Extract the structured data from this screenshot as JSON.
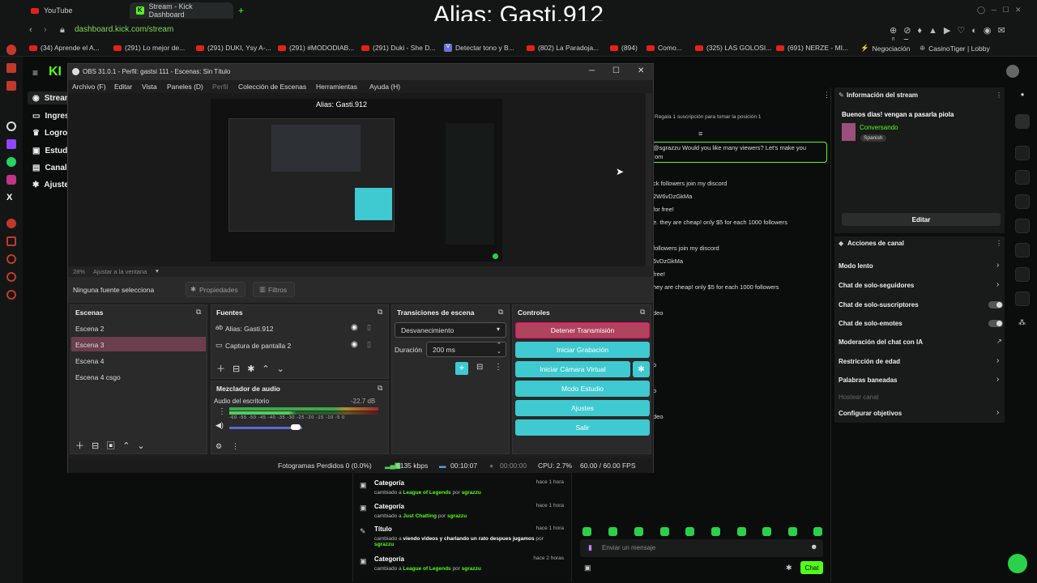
{
  "overlay_title": "Alias: Gasti.912",
  "browser": {
    "tabs": [
      {
        "label": "YouTube"
      },
      {
        "label": "Stream - Kick Dashboard"
      }
    ],
    "new_tab": "+",
    "url": "dashboard.kick.com/stream",
    "bookmarks": [
      "(34) Aprende el A...",
      "(291) Lo mejor de...",
      "(291) DUKI, Ysy A-...",
      "(291) #MODODIAB...",
      "(291) Duki - She D...",
      "Detectar tono y B...",
      "(802) La Paradoja...",
      "(894)",
      "Como...",
      "(325) LAS GOLOSI...",
      "(691) NERZE - MI...",
      "Negociación",
      "CasinoTiger | Lobby"
    ]
  },
  "kick": {
    "nav": [
      "Stream",
      "Ingres",
      "Logros",
      "Estudi",
      "Canal",
      "Ajuste"
    ],
    "chat_top": "Regala 1 suscripción para tomar la posición 1",
    "chat_messages": [
      {
        "text": "@sgrazzu Would you like many viewers? Let's make you"
      },
      {
        "text": "om"
      },
      {
        "text": "ck followers join my discord"
      },
      {
        "text": "2W6vDzGkMa"
      },
      {
        "text": "for free!"
      },
      {
        "text": "e. they are cheap! only $5 for each 1000 followers"
      },
      {
        "text": "followers join my discord"
      },
      {
        "text": "6vDzGkMa"
      },
      {
        "text": "free!"
      },
      {
        "text": "hey are cheap! only $5 for each 1000 followers"
      },
      {
        "text": "deo"
      },
      {
        "text": "o"
      },
      {
        "text": "o"
      },
      {
        "text": "deo"
      }
    ],
    "chat_input_placeholder": "Enviar un mensaje",
    "chat_button": "Chat",
    "stream_info": {
      "header": "Información del stream",
      "title": "Buenos dias! vengan a pasarla piola",
      "category": "Conversando",
      "language": "Spanish",
      "edit": "Editar"
    },
    "channel_actions": {
      "header": "Acciones de canal",
      "items": [
        {
          "label": "Modo lento",
          "control": "chevron"
        },
        {
          "label": "Chat de solo-seguidores",
          "control": "chevron"
        },
        {
          "label": "Chat de solo-suscriptores",
          "control": "toggle"
        },
        {
          "label": "Chat de solo-emotes",
          "control": "toggle"
        },
        {
          "label": "Moderación del chat con IA",
          "control": "external"
        },
        {
          "label": "Restricción de edad",
          "control": "chevron"
        },
        {
          "label": "Palabras baneadas",
          "control": "chevron"
        },
        {
          "label": "Hostear canal",
          "control": "none"
        },
        {
          "label": "Configurar objetivos",
          "control": "chevron"
        }
      ]
    },
    "activity": [
      {
        "title": "Categoría",
        "prefix": "cambiado a",
        "value": "League of Legends",
        "by": "por",
        "user": "sgrazzu",
        "time": "hace 1 hora"
      },
      {
        "title": "Categoría",
        "prefix": "cambiado a",
        "value": "Just Chatting",
        "by": "por",
        "user": "sgrazzu",
        "time": "hace 1 hora"
      },
      {
        "title": "Título",
        "prefix": "cambiado a",
        "value": "viendo videos y charlando un rato despues jugamos",
        "by": "por",
        "user": "sgrazzu",
        "time": "hace 1 hora"
      },
      {
        "title": "Categoría",
        "prefix": "cambiado a",
        "value": "League of Legends",
        "by": "por",
        "user": "sgrazzu",
        "time": "hace 2 horas"
      }
    ]
  },
  "obs": {
    "title": "OBS 31.0.1 - Perfil: gastsi 111 - Escenas: Sin Título",
    "menu": [
      "Archivo (F)",
      "Editar",
      "Vista",
      "Paneles (D)",
      "Perfil",
      "Colección de Escenas",
      "Herramientas",
      "Ayuda (H)"
    ],
    "zoom": "28%",
    "fit": "Ajustar a la ventana",
    "no_source": "Ninguna fuente selecciona",
    "properties": "Propiedades",
    "filters": "Filtros",
    "scenes_title": "Escenas",
    "scenes": [
      "Escena 2",
      "Escena 3",
      "Escena 4",
      "Escena 4 csgo"
    ],
    "selected_scene": "Escena 3",
    "sources_title": "Fuentes",
    "sources": [
      "Alias: Gasti.912",
      "Captura de pantalla 2"
    ],
    "transitions_title": "Transiciones de escena",
    "transition": "Desvanecimiento",
    "duration_label": "Duración",
    "duration": "200 ms",
    "controls_title": "Controles",
    "controls": [
      "Detener Transmisión",
      "Iniciar Grabación",
      "Iniciar Cámara Virtual",
      "Modo Estudio",
      "Ajustes",
      "Salir"
    ],
    "mixer_title": "Mezclador de audio",
    "mixer_channel": "Audio del escritorio",
    "mixer_db": "-22.7 dB",
    "mixer_scale": [
      "-60",
      "-55",
      "-50",
      "-45",
      "-40",
      "-35",
      "-30",
      "-25",
      "-20",
      "-15",
      "-10",
      "-5",
      "0"
    ],
    "status": {
      "dropped": "Fotogramas Perdidos 0 (0.0%)",
      "bitrate": "6135 kbps",
      "stream_time": "00:10:07",
      "rec_time": "00:00:00",
      "cpu": "CPU: 2.7%",
      "fps": "60.00 / 60.00 FPS"
    }
  },
  "colors": {
    "kick_green": "#53fc18",
    "obs_button": "#3fc9d1",
    "obs_stop": "#b0435e"
  }
}
